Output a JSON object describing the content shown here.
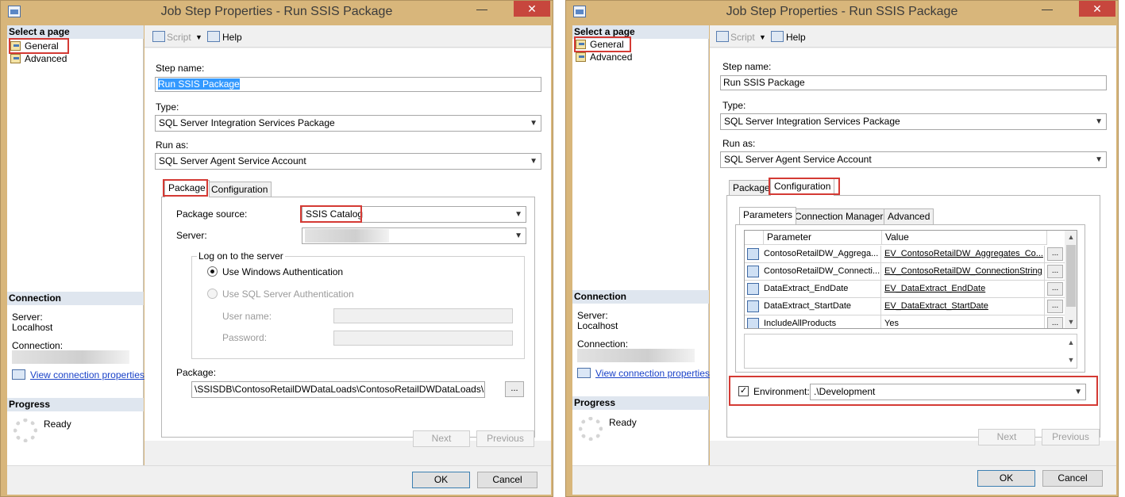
{
  "title": "Job Step Properties - Run SSIS Package",
  "window_buttons": {
    "minimize": "—",
    "close": "✕"
  },
  "left": {
    "select_page": "Select a page",
    "pages": [
      "General",
      "Advanced"
    ],
    "connection": {
      "header": "Connection",
      "server_label": "Server:",
      "server_value": "Localhost",
      "connection_label": "Connection:",
      "view_link": "View connection properties"
    },
    "progress": {
      "header": "Progress",
      "status": "Ready"
    }
  },
  "toolbar": {
    "script": "Script",
    "help": "Help"
  },
  "general": {
    "step_name_label": "Step name:",
    "step_name": "Run SSIS Package",
    "type_label": "Type:",
    "type_value": "SQL Server Integration Services Package",
    "run_as_label": "Run as:",
    "run_as_value": "SQL Server Agent Service Account",
    "tabs": [
      "Package",
      "Configuration"
    ]
  },
  "package_tab": {
    "source_label": "Package source:",
    "source_value": "SSIS Catalog",
    "server_label": "Server:",
    "logon_group": "Log on to the server",
    "windows_auth": "Use Windows Authentication",
    "sql_auth": "Use SQL Server Authentication",
    "username_label": "User name:",
    "password_label": "Password:",
    "package_label": "Package:",
    "package_path": "\\SSISDB\\ContosoRetailDWDataLoads\\ContosoRetailDWDataLoads\\Produ",
    "browse": "..."
  },
  "config_tab": {
    "subtabs": [
      "Parameters",
      "Connection Managers",
      "Advanced"
    ],
    "columns": [
      "Parameter",
      "Value"
    ],
    "rows": [
      {
        "param": "ContosoRetailDW_Aggrega...",
        "value": "EV_ContosoRetailDW_Aggregates_Co..."
      },
      {
        "param": "ContosoRetailDW_Connecti...",
        "value": "EV_ContosoRetailDW_ConnectionString"
      },
      {
        "param": "DataExtract_EndDate",
        "value": "EV_DataExtract_EndDate"
      },
      {
        "param": "DataExtract_StartDate",
        "value": "EV_DataExtract_StartDate"
      },
      {
        "param": "IncludeAllProducts",
        "value": "Yes"
      }
    ],
    "cell_button": "...",
    "environment_label": "Environment:",
    "environment_value": ".\\Development",
    "checkmark": "✓"
  },
  "nav": {
    "next": "Next",
    "previous": "Previous"
  },
  "footer": {
    "ok": "OK",
    "cancel": "Cancel"
  },
  "colors": {
    "highlight": "#d43a34",
    "frame": "#d8b67b",
    "link": "#1a42c8"
  }
}
